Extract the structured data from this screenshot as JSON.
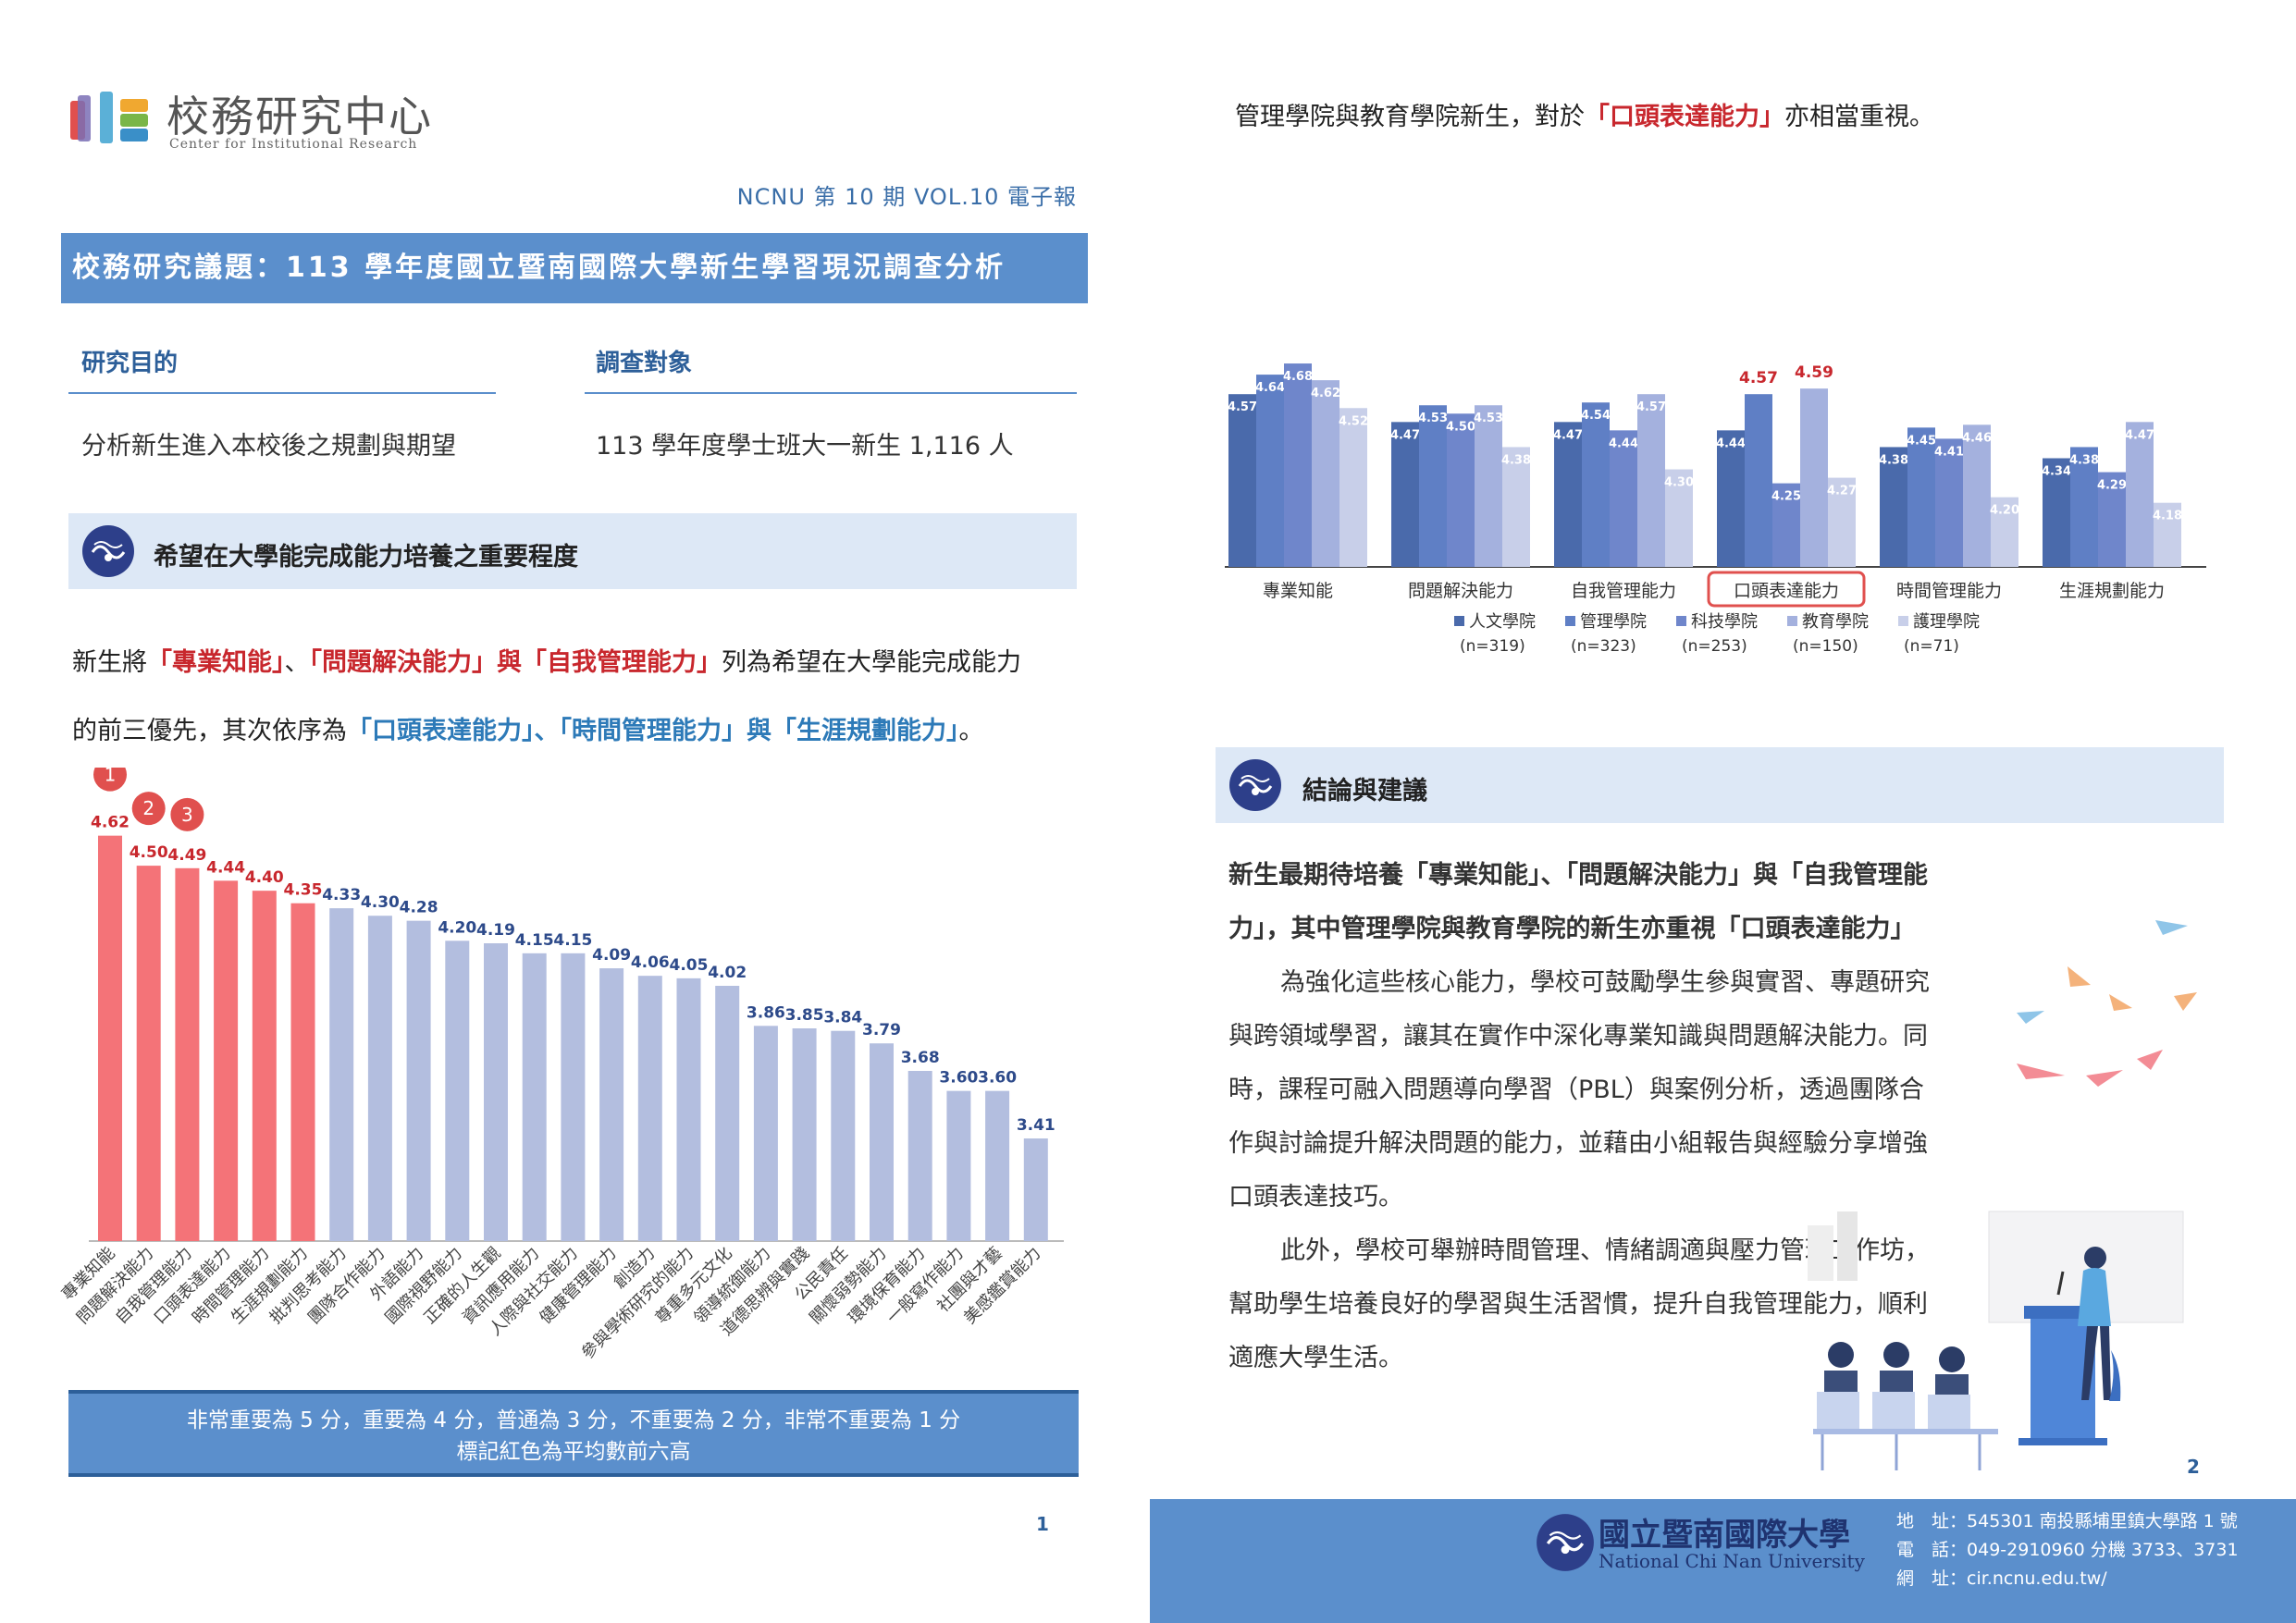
{
  "header": {
    "logo_title": "校務研究中心",
    "logo_subtitle": "Center for Institutional Research",
    "issue": "NCNU  第 10 期  VOL.10  電子報",
    "title": "校務研究議題：113 學年度國立暨南國際大學新生學習現況調查分析"
  },
  "info": {
    "purpose_label": "研究目的",
    "purpose_text": "分析新生進入本校後之規劃與期望",
    "target_label": "調查對象",
    "target_text": "113 學年度學士班大一新生 1,116 人"
  },
  "section1": {
    "title": "希望在大學能完成能力培養之重要程度",
    "p1_a": "新生將",
    "p1_r1": "「專業知能」",
    "p1_sep1": "、",
    "p1_r2": "「問題解決能力」",
    "p1_and": "與",
    "p1_r3": "「自我管理能力」",
    "p1_end": "列為希望在大學能完成能力",
    "p2_a": "的前三優先，其次依序為",
    "p2_b1": "「口頭表達能力」",
    "p2_sep1": "、",
    "p2_b2": "「時間管理能力」",
    "p2_and": "與",
    "p2_b3": "「生涯規劃能力」",
    "p2_end": "。",
    "note_line1": "非常重要為 5 分，重要為 4 分，普通為 3 分，不重要為 2 分，非常不重要為 1 分",
    "note_line2": "標記紅色為平均數前六高",
    "page": "1"
  },
  "right": {
    "intro_a": "管理學院與教育學院新生，對於",
    "intro_r": "「口頭表達能力」",
    "intro_b": "亦相當重視。",
    "concl_title": "結論與建議",
    "concl_b1": "新生最期待培養「專業知能」、「問題解決能力」與「自我管理能",
    "concl_b2": "力」，其中管理學院與教育學院的新生亦重視「口頭表達能力」",
    "concl_l1": "為強化這些核心能力，學校可鼓勵學生參與實習、專題研究",
    "concl_l2": "與跨領域學習，讓其在實作中深化專業知識與問題解決能力。同",
    "concl_l3": "時，課程可融入問題導向學習（PBL）與案例分析，透過團隊合",
    "concl_l4": "作與討論提升解決問題的能力，並藉由小組報告與經驗分享增強",
    "concl_l5": "口頭表達技巧。",
    "concl_l6": "此外，學校可舉辦時間管理、情緒調適與壓力管理工作坊，",
    "concl_l7": "幫助學生培養良好的學習與生活習慣，提升自我管理能力，順利",
    "concl_l8": "適應大學生活。",
    "page": "2"
  },
  "footer": {
    "university_cn": "國立暨南國際大學",
    "university_en": "National Chi Nan University",
    "addr_label": "地　址：",
    "addr": "545301 南投縣埔里鎮大學路 1 號",
    "tel_label": "電　話：",
    "tel": "049-2910960 分機 3733、3731",
    "web_label": "網　址：",
    "web": "cir.ncnu.edu.tw/"
  },
  "colors": {
    "red_bar": "#f47378",
    "blue_bar": "#b3bedf",
    "red_label": "#c8272d",
    "blue_label": "#2d4a8a",
    "accent": "#5b8fcc"
  },
  "chart_data": [
    {
      "type": "bar",
      "categories": [
        "專業知能",
        "問題解決能力",
        "自我管理能力",
        "口頭表達能力",
        "時間管理能力",
        "生涯規劃能力",
        "批判思考能力",
        "團隊合作能力",
        "外語能力",
        "國際視野能力",
        "正確的人生觀",
        "資訊應用能力",
        "人際與社交能力",
        "健康管理能力",
        "創造力",
        "參與學術研究的能力",
        "尊重多元文化",
        "領導統御能力",
        "道德思辨與實踐",
        "公民責任",
        "關懷弱勢能力",
        "環境保育能力",
        "一般寫作能力",
        "社團與才藝",
        "美感鑑賞能力"
      ],
      "values": [
        4.62,
        4.5,
        4.49,
        4.44,
        4.4,
        4.35,
        4.33,
        4.3,
        4.28,
        4.2,
        4.19,
        4.15,
        4.15,
        4.09,
        4.06,
        4.05,
        4.02,
        3.86,
        3.85,
        3.84,
        3.79,
        3.68,
        3.6,
        3.6,
        3.41
      ],
      "labels": [
        "4.62",
        "4.50",
        "4.49",
        "4.44",
        "4.40",
        "4.35",
        "4.33",
        "4.30",
        "4.28",
        "4.20",
        "4.19",
        "4.15",
        "4.15",
        "4.09",
        "4.06",
        "4.05",
        "4.02",
        "3.86",
        "3.85",
        "3.84",
        "3.79",
        "3.68",
        "3.60",
        "3.60",
        "3.41"
      ],
      "highlight_top": 6,
      "rank_badges": [
        "1",
        "2",
        "3"
      ],
      "ylim": [
        3.0,
        4.7
      ]
    },
    {
      "type": "bar",
      "categories": [
        "專業知能",
        "問題解決能力",
        "自我管理能力",
        "口頭表達能力",
        "時間管理能力",
        "生涯規劃能力"
      ],
      "highlight_category": "口頭表達能力",
      "series": [
        {
          "name": "人文學院",
          "n": "(n=319)",
          "color": "#4a6aab",
          "values": [
            4.57,
            4.47,
            4.47,
            4.44,
            4.38,
            4.34
          ],
          "labels": [
            "4.57",
            "4.47",
            "4.47",
            "4.44",
            "4.38",
            "4.34"
          ]
        },
        {
          "name": "管理學院",
          "n": "(n=323)",
          "color": "#5f7fc5",
          "values": [
            4.64,
            4.53,
            4.54,
            4.57,
            4.45,
            4.38
          ],
          "labels": [
            "4.64",
            "4.53",
            "4.54",
            "4.57",
            "4.45",
            "4.38"
          ]
        },
        {
          "name": "科技學院",
          "n": "(n=253)",
          "color": "#6f86cb",
          "values": [
            4.68,
            4.5,
            4.44,
            4.25,
            4.41,
            4.29
          ],
          "labels": [
            "4.68",
            "4.50",
            "4.44",
            "4.25",
            "4.41",
            "4.29"
          ]
        },
        {
          "name": "教育學院",
          "n": "(n=150)",
          "color": "#a4b1de",
          "values": [
            4.62,
            4.53,
            4.57,
            4.59,
            4.46,
            4.47
          ],
          "labels": [
            "4.62",
            "4.53",
            "4.57",
            "4.59",
            "4.46",
            "4.47"
          ]
        },
        {
          "name": "護理學院",
          "n": "(n=71)",
          "color": "#c8cfe9",
          "values": [
            4.52,
            4.38,
            4.3,
            4.27,
            4.2,
            4.18
          ],
          "labels": [
            "4.52",
            "4.38",
            "4.30",
            "4.27",
            "4.20",
            "4.18"
          ]
        }
      ],
      "red_labels": [
        [
          3,
          1
        ],
        [
          3,
          3
        ]
      ],
      "ylim": [
        3.95,
        4.72
      ]
    }
  ]
}
